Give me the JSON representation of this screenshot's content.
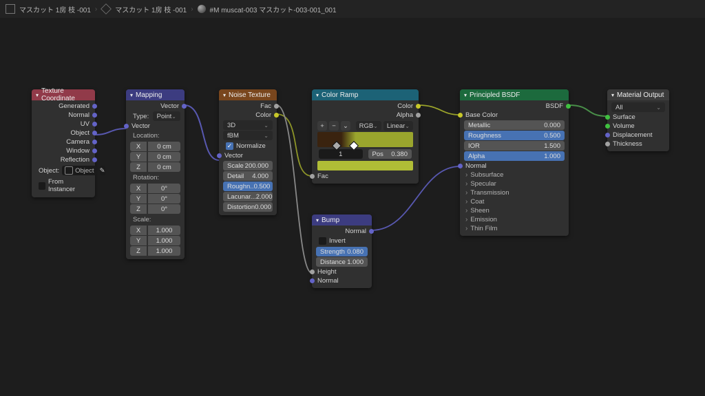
{
  "breadcrumb": [
    {
      "label": "マスカット 1房 枝 -001"
    },
    {
      "label": "マスカット 1房 枝 -001"
    },
    {
      "label": "#M muscat-003 マスカット-003-001_001"
    }
  ],
  "nodes": {
    "tex_coord": {
      "title": "Texture Coordinate",
      "outputs": [
        "Generated",
        "Normal",
        "UV",
        "Object",
        "Camera",
        "Window",
        "Reflection"
      ],
      "object_label": "Object:",
      "object_placeholder": "Object",
      "from_instancer": "From Instancer"
    },
    "mapping": {
      "title": "Mapping",
      "out_vector": "Vector",
      "type_label": "Type:",
      "type_value": "Point",
      "in_vector": "Vector",
      "location_label": "Location:",
      "location": {
        "X": "0 cm",
        "Y": "0 cm",
        "Z": "0 cm"
      },
      "rotation_label": "Rotation:",
      "rotation": {
        "X": "0°",
        "Y": "0°",
        "Z": "0°"
      },
      "scale_label": "Scale:",
      "scale": {
        "X": "1.000",
        "Y": "1.000",
        "Z": "1.000"
      }
    },
    "noise": {
      "title": "Noise Texture",
      "out_fac": "Fac",
      "out_color": "Color",
      "dim": "3D",
      "fractal": "fBM",
      "normalize": "Normalize",
      "in_vector": "Vector",
      "scale": {
        "l": "Scale",
        "v": "200.000"
      },
      "detail": {
        "l": "Detail",
        "v": "4.000"
      },
      "rough": {
        "l": "Roughn..",
        "v": "0.500"
      },
      "lacunarity": {
        "l": "Lacunar...",
        "v": "2.000"
      },
      "distortion": {
        "l": "Distortion",
        "v": "0.000"
      }
    },
    "color_ramp": {
      "title": "Color Ramp",
      "out_color": "Color",
      "out_alpha": "Alpha",
      "mode1": "RGB",
      "mode2": "Linear",
      "idx": "1",
      "pos_label": "Pos",
      "pos_value": "0.380",
      "in_fac": "Fac"
    },
    "bump": {
      "title": "Bump",
      "out_normal": "Normal",
      "invert": "Invert",
      "strength": {
        "l": "Strength",
        "v": "0.080"
      },
      "distance": {
        "l": "Distance",
        "v": "1.000"
      },
      "in_height": "Height",
      "in_normal": "Normal"
    },
    "principled": {
      "title": "Principled BSDF",
      "out_bsdf": "BSDF",
      "base_color": "Base Color",
      "metallic": {
        "l": "Metallic",
        "v": "0.000"
      },
      "roughness": {
        "l": "Roughness",
        "v": "0.500"
      },
      "ior": {
        "l": "IOR",
        "v": "1.500"
      },
      "alpha": {
        "l": "Alpha",
        "v": "1.000"
      },
      "normal": "Normal",
      "panels": [
        "Subsurface",
        "Specular",
        "Transmission",
        "Coat",
        "Sheen",
        "Emission",
        "Thin Film"
      ]
    },
    "mat_output": {
      "title": "Material Output",
      "target": "All",
      "surface": "Surface",
      "volume": "Volume",
      "displacement": "Displacement",
      "thickness": "Thickness"
    }
  }
}
